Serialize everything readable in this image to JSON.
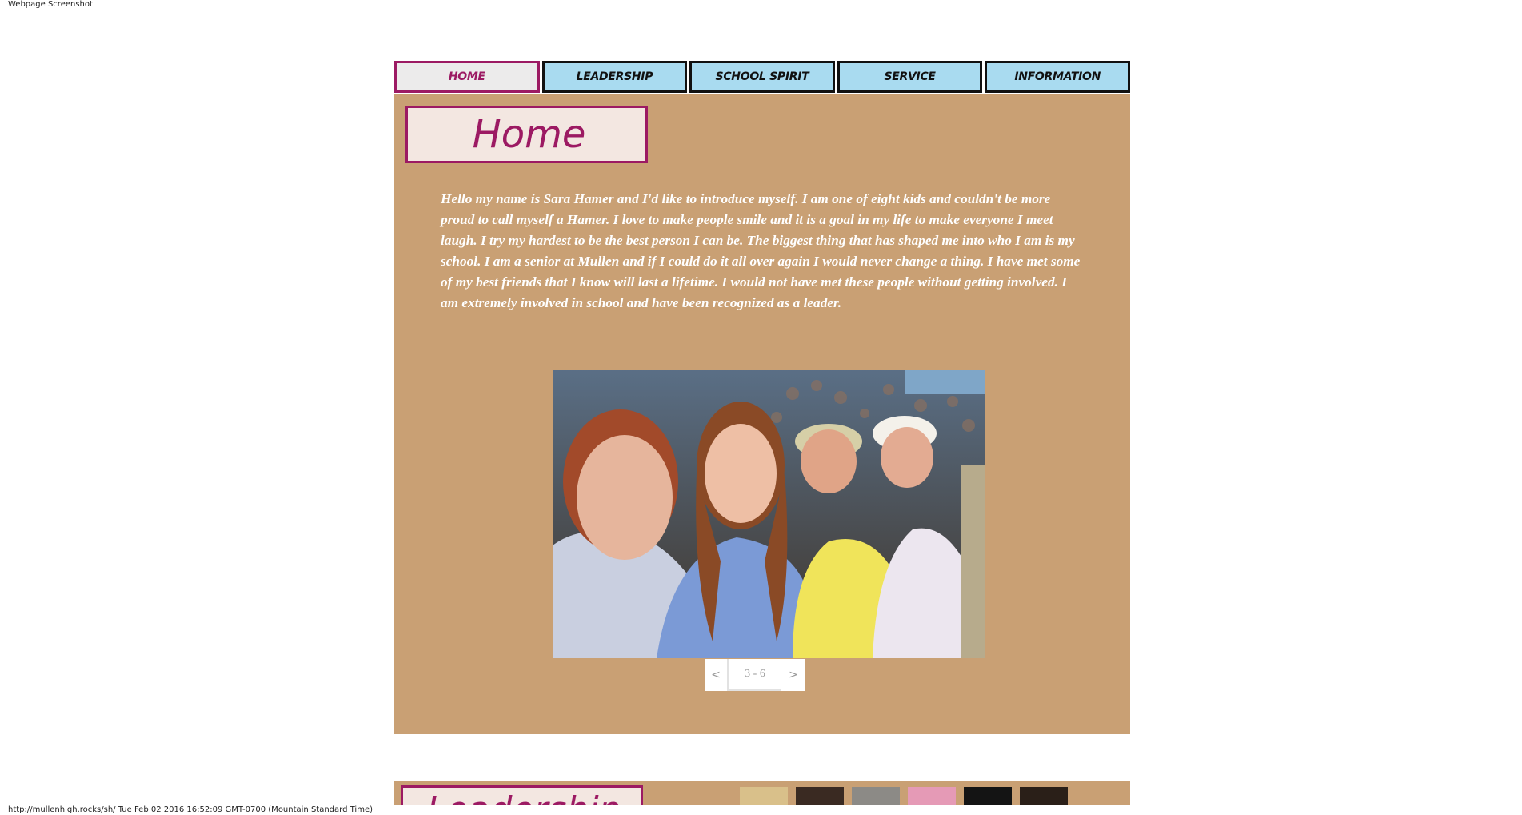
{
  "caption_top": "Webpage Screenshot",
  "caption_bottom": "http://mullenhigh.rocks/sh/ Tue Feb 02 2016 16:52:09 GMT-0700 (Mountain Standard Time)",
  "nav": {
    "tabs": [
      {
        "label": "Home"
      },
      {
        "label": "Leadership"
      },
      {
        "label": "School Spirit"
      },
      {
        "label": "Service"
      },
      {
        "label": "Information"
      }
    ]
  },
  "home": {
    "heading": "Home",
    "intro": "Hello my name is Sara Hamer and I'd like to introduce myself. I am one of eight kids and couldn't be more proud to call myself a Hamer. I love to make people smile and it is a goal in my life to make everyone I meet laugh. I try my hardest to be the best person I can be. The biggest thing that has shaped me into who I am is my school. I am a senior at Mullen and if I could do it all over again I would never change a thing. I have met some of my best friends that I know will last a lifetime. I would not have met these people without getting involved. I am extremely involved in school and have been recognized as a leader.",
    "slider": {
      "prev": "<",
      "counter": "3 - 6",
      "next": ">"
    }
  },
  "next_section": {
    "heading_fragment": "Leadership"
  },
  "colors": {
    "panel_bg": "#c9a074",
    "accent": "#9c1a63",
    "tab_bg": "#a9dbf0",
    "heading_bg": "#f3e7e1"
  }
}
